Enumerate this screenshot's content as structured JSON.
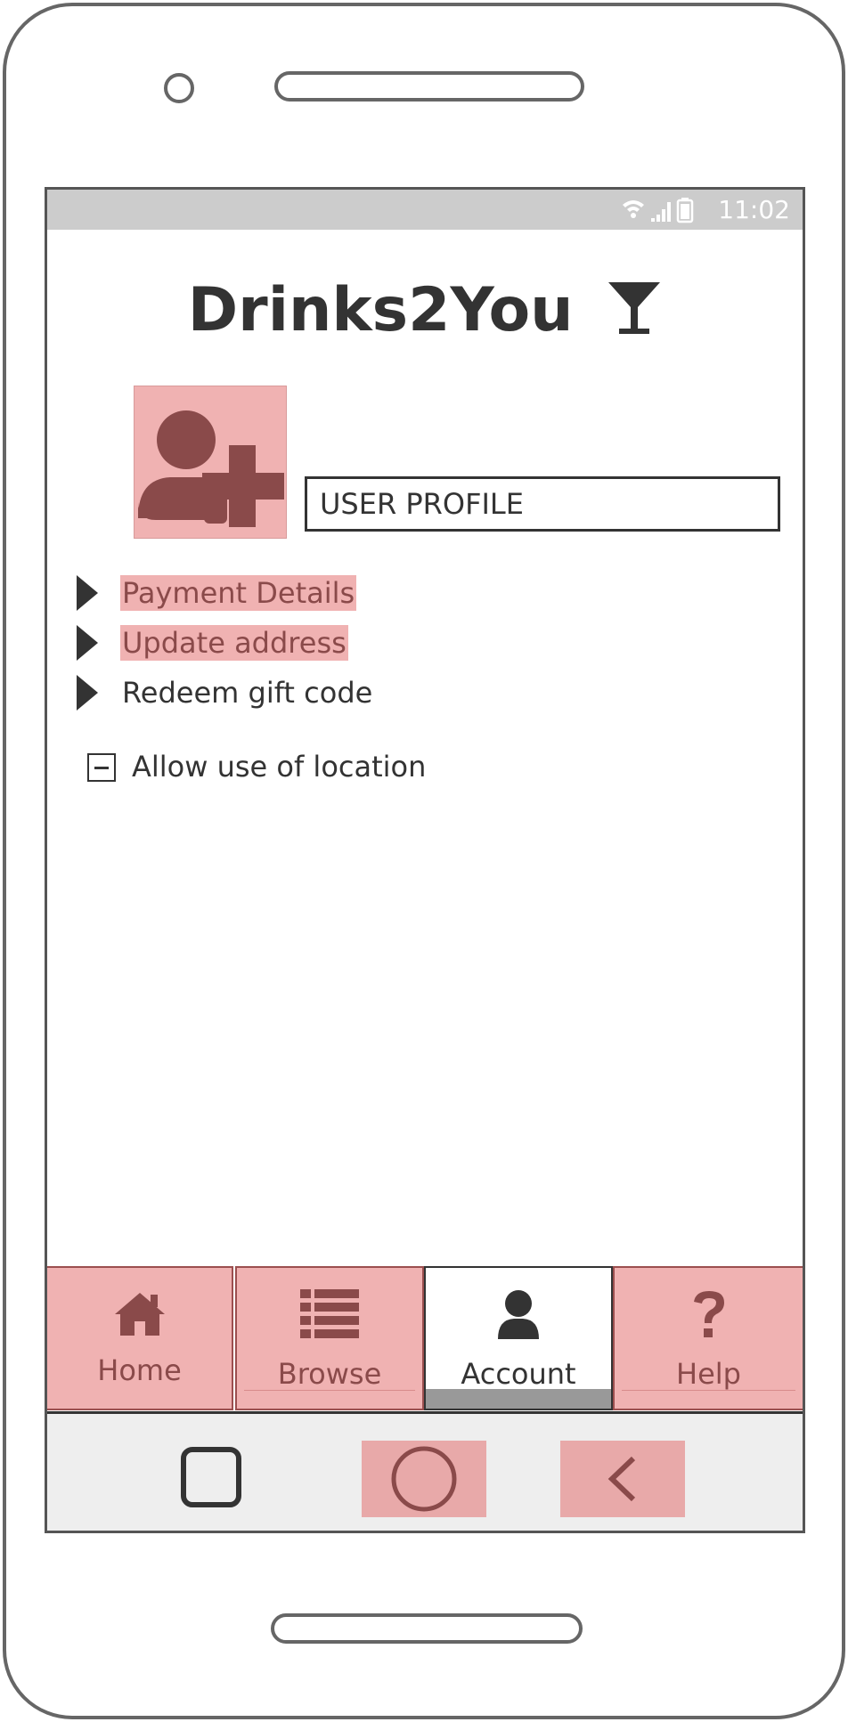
{
  "status_bar": {
    "time": "11:02",
    "icons": [
      "wifi-icon",
      "signal-icon",
      "battery-icon"
    ]
  },
  "app": {
    "title": "Drinks2You",
    "title_icon": "cocktail-glass-icon"
  },
  "profile": {
    "avatar_icon": "add-user-icon",
    "input_value": "USER PROFILE"
  },
  "menu": {
    "items": [
      {
        "label": "Payment Details",
        "highlighted": true
      },
      {
        "label": "Update address",
        "highlighted": true
      },
      {
        "label": "Redeem gift code",
        "highlighted": false
      }
    ]
  },
  "location": {
    "label": "Allow use of location",
    "state": "indeterminate"
  },
  "tabs": [
    {
      "label": "Home",
      "icon": "home-icon",
      "active": false
    },
    {
      "label": "Browse",
      "icon": "list-icon",
      "active": false
    },
    {
      "label": "Account",
      "icon": "user-icon",
      "active": true
    },
    {
      "label": "Help",
      "icon": "question-icon",
      "active": false
    }
  ],
  "nav": {
    "buttons": [
      "recent-apps-icon",
      "home-circle-icon",
      "back-icon"
    ]
  },
  "colors": {
    "highlight": "#f0b2b2",
    "highlight_text": "#8a4a4a",
    "dark": "#333333",
    "status_bar": "#cccccc",
    "nav_bar": "#eeeeee"
  }
}
